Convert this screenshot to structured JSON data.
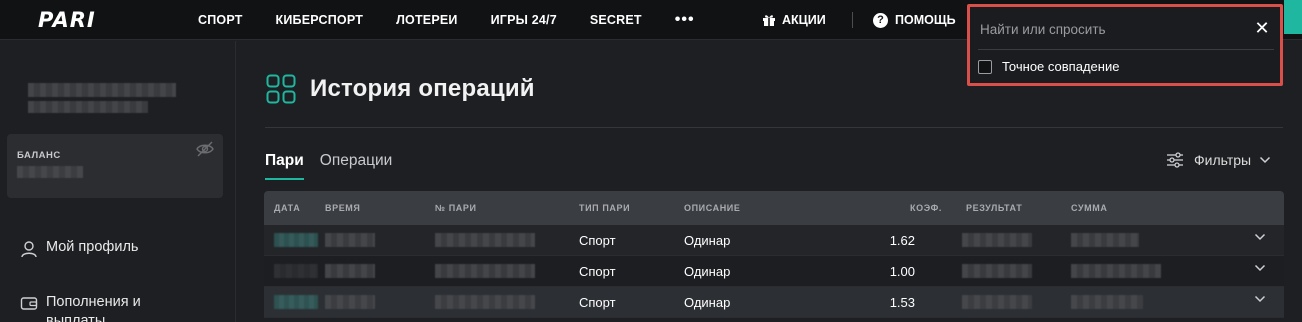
{
  "header": {
    "logo": "PARI",
    "nav": [
      "СПОРТ",
      "КИБЕРСПОРТ",
      "ЛОТЕРЕИ",
      "ИГРЫ 24/7",
      "SECRET"
    ],
    "more": "•••",
    "promo_label": "АКЦИИ",
    "help_label": "ПОМОЩЬ",
    "accent_color": "#1fb7a0"
  },
  "search": {
    "placeholder": "Найти или спросить",
    "value": "",
    "exact_match_label": "Точное совпадение",
    "exact_match_checked": false,
    "highlight_color": "#d9504a"
  },
  "sidebar": {
    "balance_label": "БАЛАНС",
    "items": [
      {
        "label": "Мой профиль",
        "icon": "user-icon"
      },
      {
        "label": "Пополнения и выплаты",
        "icon": "wallet-icon"
      }
    ]
  },
  "main": {
    "title": "История операций",
    "tabs": [
      {
        "label": "Пари",
        "active": true
      },
      {
        "label": "Операции",
        "active": false
      }
    ],
    "filters_label": "Фильтры"
  },
  "table": {
    "columns": [
      "ДАТА",
      "ВРЕМЯ",
      "№ ПАРИ",
      "ТИП ПАРИ",
      "ОПИСАНИЕ",
      "КОЭФ.",
      "РЕЗУЛЬТАТ",
      "СУММА"
    ],
    "rows": [
      {
        "type": "Спорт",
        "description": "Одинар",
        "coef": "1.62"
      },
      {
        "type": "Спорт",
        "description": "Одинар",
        "coef": "1.00"
      },
      {
        "type": "Спорт",
        "description": "Одинар",
        "coef": "1.53"
      }
    ]
  }
}
